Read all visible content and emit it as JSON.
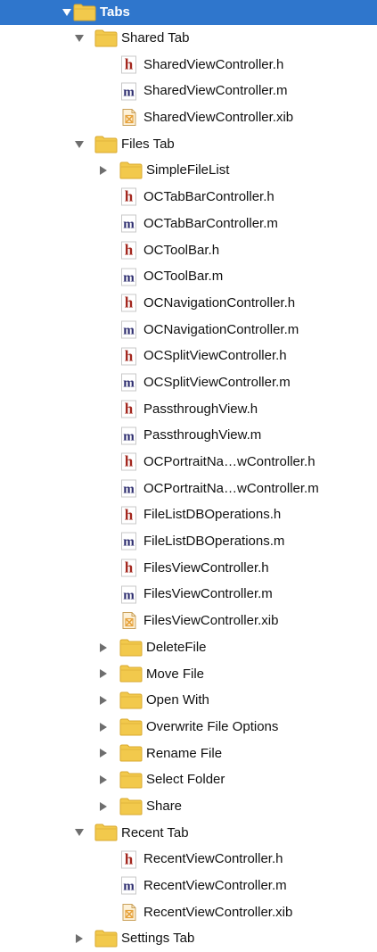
{
  "navigator": {
    "items": [
      {
        "label": "Tabs",
        "kind": "folder",
        "depth": 0,
        "disclosure": "open",
        "selected": true,
        "icon": "folder-icon"
      },
      {
        "label": "Shared Tab",
        "kind": "folder",
        "depth": 1,
        "disclosure": "open",
        "icon": "folder-icon"
      },
      {
        "label": "SharedViewController.h",
        "kind": "h",
        "depth": 2,
        "icon": "header-file-icon"
      },
      {
        "label": "SharedViewController.m",
        "kind": "m",
        "depth": 2,
        "icon": "implementation-file-icon"
      },
      {
        "label": "SharedViewController.xib",
        "kind": "xib",
        "depth": 2,
        "icon": "xib-file-icon"
      },
      {
        "label": "Files Tab",
        "kind": "folder",
        "depth": 1,
        "disclosure": "open",
        "icon": "folder-icon"
      },
      {
        "label": "SimpleFileList",
        "kind": "folder",
        "depth": 2,
        "disclosure": "closed",
        "icon": "folder-icon"
      },
      {
        "label": "OCTabBarController.h",
        "kind": "h",
        "depth": 2,
        "icon": "header-file-icon"
      },
      {
        "label": "OCTabBarController.m",
        "kind": "m",
        "depth": 2,
        "icon": "implementation-file-icon"
      },
      {
        "label": "OCToolBar.h",
        "kind": "h",
        "depth": 2,
        "icon": "header-file-icon"
      },
      {
        "label": "OCToolBar.m",
        "kind": "m",
        "depth": 2,
        "icon": "implementation-file-icon"
      },
      {
        "label": "OCNavigationController.h",
        "kind": "h",
        "depth": 2,
        "icon": "header-file-icon"
      },
      {
        "label": "OCNavigationController.m",
        "kind": "m",
        "depth": 2,
        "icon": "implementation-file-icon"
      },
      {
        "label": "OCSplitViewController.h",
        "kind": "h",
        "depth": 2,
        "icon": "header-file-icon"
      },
      {
        "label": "OCSplitViewController.m",
        "kind": "m",
        "depth": 2,
        "icon": "implementation-file-icon"
      },
      {
        "label": "PassthroughView.h",
        "kind": "h",
        "depth": 2,
        "icon": "header-file-icon"
      },
      {
        "label": "PassthroughView.m",
        "kind": "m",
        "depth": 2,
        "icon": "implementation-file-icon"
      },
      {
        "label": "OCPortraitNa…wController.h",
        "kind": "h",
        "depth": 2,
        "icon": "header-file-icon"
      },
      {
        "label": "OCPortraitNa…wController.m",
        "kind": "m",
        "depth": 2,
        "icon": "implementation-file-icon"
      },
      {
        "label": "FileListDBOperations.h",
        "kind": "h",
        "depth": 2,
        "icon": "header-file-icon"
      },
      {
        "label": "FileListDBOperations.m",
        "kind": "m",
        "depth": 2,
        "icon": "implementation-file-icon"
      },
      {
        "label": "FilesViewController.h",
        "kind": "h",
        "depth": 2,
        "icon": "header-file-icon"
      },
      {
        "label": "FilesViewController.m",
        "kind": "m",
        "depth": 2,
        "icon": "implementation-file-icon"
      },
      {
        "label": "FilesViewController.xib",
        "kind": "xib",
        "depth": 2,
        "icon": "xib-file-icon"
      },
      {
        "label": "DeleteFile",
        "kind": "folder",
        "depth": 2,
        "disclosure": "closed",
        "icon": "folder-icon"
      },
      {
        "label": "Move File",
        "kind": "folder",
        "depth": 2,
        "disclosure": "closed",
        "icon": "folder-icon"
      },
      {
        "label": "Open With",
        "kind": "folder",
        "depth": 2,
        "disclosure": "closed",
        "icon": "folder-icon"
      },
      {
        "label": "Overwrite File Options",
        "kind": "folder",
        "depth": 2,
        "disclosure": "closed",
        "icon": "folder-icon"
      },
      {
        "label": "Rename File",
        "kind": "folder",
        "depth": 2,
        "disclosure": "closed",
        "icon": "folder-icon"
      },
      {
        "label": "Select Folder",
        "kind": "folder",
        "depth": 2,
        "disclosure": "closed",
        "icon": "folder-icon"
      },
      {
        "label": "Share",
        "kind": "folder",
        "depth": 2,
        "disclosure": "closed",
        "icon": "folder-icon"
      },
      {
        "label": "Recent Tab",
        "kind": "folder",
        "depth": 1,
        "disclosure": "open",
        "icon": "folder-icon"
      },
      {
        "label": "RecentViewController.h",
        "kind": "h",
        "depth": 2,
        "icon": "header-file-icon"
      },
      {
        "label": "RecentViewController.m",
        "kind": "m",
        "depth": 2,
        "icon": "implementation-file-icon"
      },
      {
        "label": "RecentViewController.xib",
        "kind": "xib",
        "depth": 2,
        "icon": "xib-file-icon"
      },
      {
        "label": "Settings Tab",
        "kind": "folder",
        "depth": 1,
        "disclosure": "closed",
        "icon": "folder-icon"
      }
    ]
  },
  "colors": {
    "selection": "#2f76cc",
    "folder": "#f2c94c",
    "header_badge": "#a3271e",
    "impl_badge": "#2c2c6e",
    "xib_badge": "#e6a23c",
    "disclosure": "#6e6e6e"
  }
}
